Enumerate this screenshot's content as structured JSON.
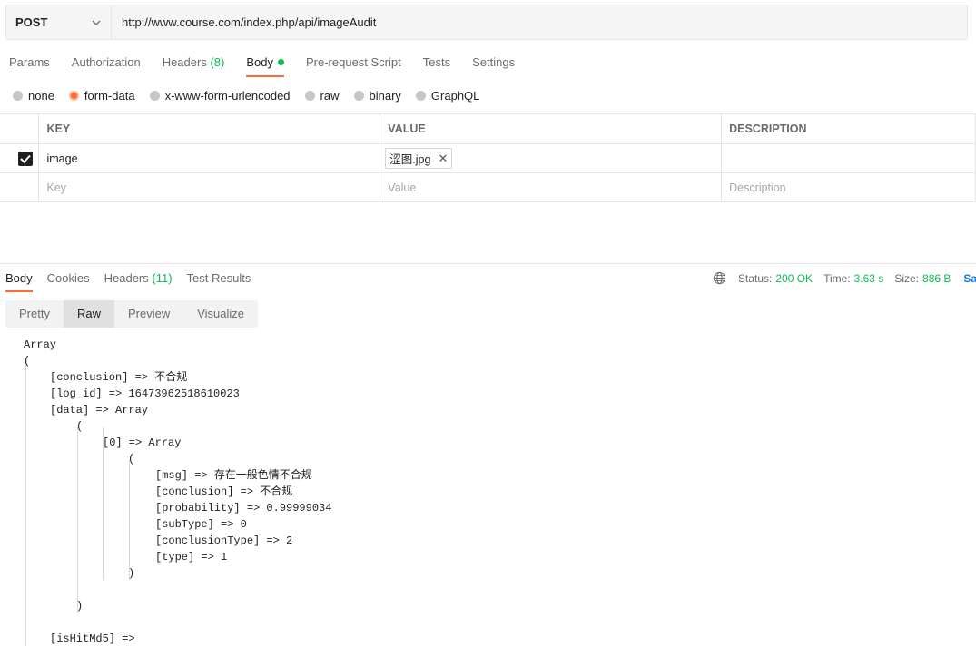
{
  "request": {
    "method": "POST",
    "url": "http://www.course.com/index.php/api/imageAudit"
  },
  "req_tabs": {
    "params": "Params",
    "authorization": "Authorization",
    "headers": "Headers",
    "headers_count": "(8)",
    "body": "Body",
    "prerequest": "Pre-request Script",
    "tests": "Tests",
    "settings": "Settings"
  },
  "body_types": {
    "none": "none",
    "form_data": "form-data",
    "urlencoded": "x-www-form-urlencoded",
    "raw": "raw",
    "binary": "binary",
    "graphql": "GraphQL"
  },
  "kv_table": {
    "headers": {
      "key": "KEY",
      "value": "VALUE",
      "description": "DESCRIPTION"
    },
    "row1": {
      "key": "image",
      "file": "涩图.jpg",
      "remove": "✕"
    },
    "placeholders": {
      "key": "Key",
      "value": "Value",
      "description": "Description"
    }
  },
  "resp_tabs": {
    "body": "Body",
    "cookies": "Cookies",
    "headers": "Headers",
    "headers_count": "(11)",
    "test_results": "Test Results"
  },
  "status": {
    "status_label": "Status:",
    "status_value": "200 OK",
    "time_label": "Time:",
    "time_value": "3.63 s",
    "size_label": "Size:",
    "size_value": "886 B",
    "save_text": "Sa"
  },
  "view_modes": {
    "pretty": "Pretty",
    "raw": "Raw",
    "preview": "Preview",
    "visualize": "Visualize"
  },
  "response_lines": [
    "Array",
    "(",
    "[conclusion] => 不合规",
    "[log_id] => 16473962518610023",
    "[data] => Array",
    "(",
    "[0] => Array",
    "(",
    "[msg] => 存在一般色情不合规",
    "[conclusion] => 不合规",
    "[probability] => 0.99999034",
    "[subType] => 0",
    "[conclusionType] => 2",
    "[type] => 1",
    ")",
    ")",
    "[isHitMd5] =>"
  ]
}
